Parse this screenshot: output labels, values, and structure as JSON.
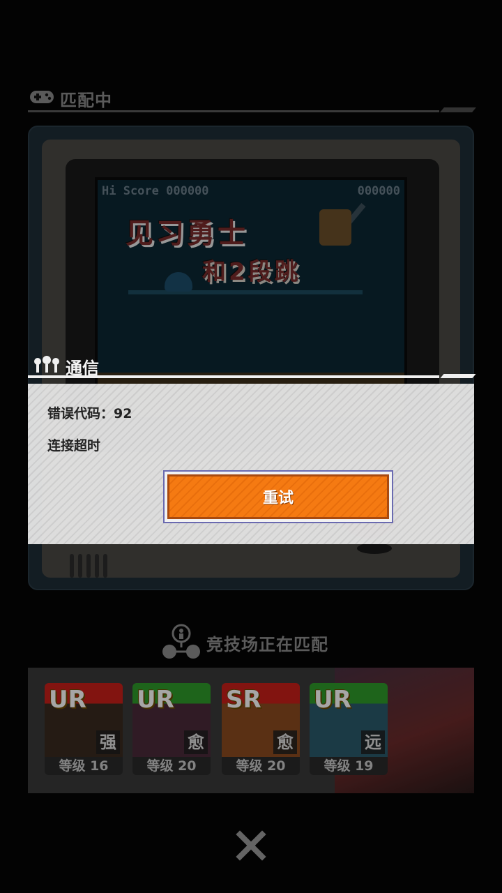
{
  "matching": {
    "title": "匹配中"
  },
  "game_screen": {
    "hi_score_label": "Hi Score 000000",
    "score": "000000",
    "title_line1": "见习勇士",
    "title_line2": "和2段跳"
  },
  "dialog": {
    "header": "通信",
    "error_code": "错误代码：92",
    "message": "连接超时",
    "retry_label": "重试"
  },
  "arena": {
    "title": "竞技场正在匹配",
    "cards": [
      {
        "rarity": "UR",
        "role": "强",
        "level": "等级 16",
        "color": "#c8201a"
      },
      {
        "rarity": "UR",
        "role": "愈",
        "level": "等级 20",
        "color": "#2e9a2a"
      },
      {
        "rarity": "SR",
        "role": "愈",
        "level": "等级 20",
        "color": "#c8201a"
      },
      {
        "rarity": "UR",
        "role": "远",
        "level": "等级 19",
        "color": "#2e9a2a"
      }
    ]
  },
  "icons": {
    "header": "gamepad-icon",
    "dialog": "communication-icon",
    "arena": "network-icon",
    "close": "close-icon"
  }
}
